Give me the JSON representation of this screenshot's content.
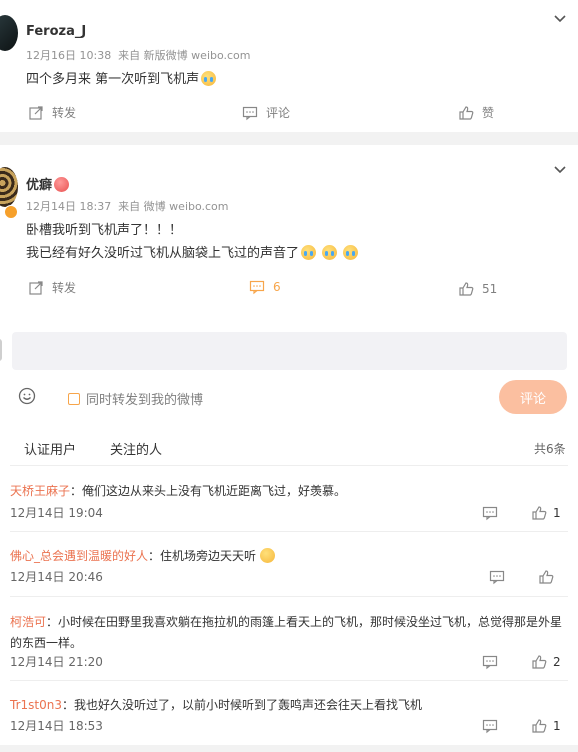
{
  "post1": {
    "user": "Feroza_J",
    "meta": "12月16日 10:38  来自 新版微博 weibo.com",
    "text": "四个多月来 第一次听到飞机声",
    "repost_label": "转发",
    "comment_label": "评论",
    "like_label": "赞"
  },
  "post2": {
    "user": "优癖",
    "meta": "12月14日 18:37  来自 微博 weibo.com",
    "text_line1": "卧槽我听到飞机声了！！！",
    "text_line2": "我已经有好久没听过飞机从脑袋上飞过的声音了",
    "repost_label": "转发",
    "comment_count": "6",
    "like_count": "51"
  },
  "composer": {
    "checkbox_label": "同时转发到我的微博",
    "submit_label": "评论"
  },
  "tabs": {
    "verified": "认证用户",
    "following": "关注的人",
    "total": "共6条"
  },
  "comments": [
    {
      "name": "天桥王麻子",
      "text": "：俺们这边从来头上没有飞机近距离飞过，好羡慕。",
      "time": "12月14日 19:04",
      "likes": "1"
    },
    {
      "name": "佛心_总会遇到温暖的好人",
      "text": "：住机场旁边天天听",
      "time": "12月14日 20:46",
      "likes": ""
    },
    {
      "name": "柯浩可",
      "text": "：小时候在田野里我喜欢躺在拖拉机的雨篷上看天上的飞机，那时候没坐过飞机，总觉得那是外星",
      "text2": "的东西一样。",
      "time": "12月14日 21:20",
      "likes": "2"
    },
    {
      "name": "Tr1st0n3",
      "text": "：我也好久没听过了，以前小时候听到了轰鸣声还会往天上看找飞机",
      "time": "12月14日 18:53",
      "likes": "1"
    }
  ],
  "colors": {
    "accent": "#eb7350",
    "comment_active": "#f7a54a",
    "button_disabled": "#fbbfa0",
    "separator": "#f2f2f2"
  }
}
